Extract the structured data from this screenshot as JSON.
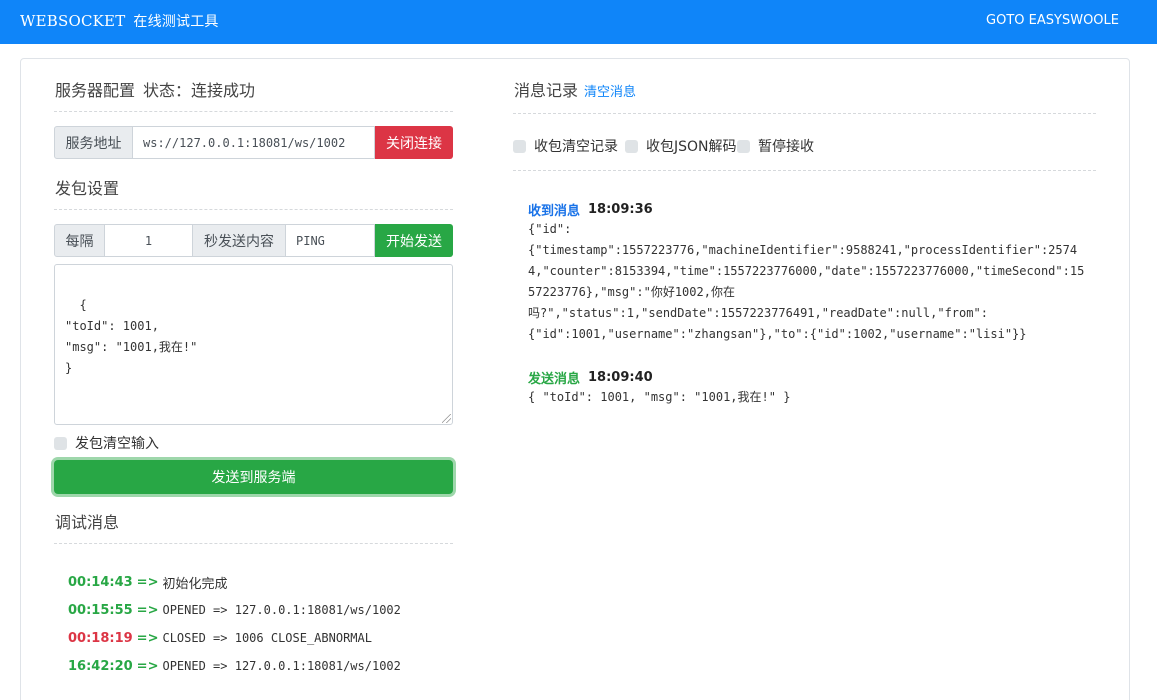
{
  "nav": {
    "brand": "WEBSOCKET",
    "subtitle": "在线测试工具",
    "link": "GOTO EASYSWOOLE"
  },
  "server": {
    "title": "服务器配置",
    "status": "状态：连接成功",
    "address_label": "服务地址",
    "address_value": "ws://127.0.0.1:18081/ws/1002",
    "close_button": "关闭连接"
  },
  "packet": {
    "title": "发包设置",
    "interval_label": "每隔",
    "interval_value": "1",
    "content_label": "秒发送内容",
    "content_value": "PING",
    "start_button": "开始发送",
    "body": "{\n\"toId\": 1001,\n\"msg\": \"1001,我在!\"\n}",
    "clear_input_label": "发包清空输入",
    "send_button": "发送到服务端"
  },
  "debug": {
    "title": "调试消息",
    "logs": [
      {
        "time": "00:14:43",
        "arrow": "=>",
        "text": "初始化完成"
      },
      {
        "time": "00:15:55",
        "arrow": "=>",
        "text": "OPENED => 127.0.0.1:18081/ws/1002"
      },
      {
        "time": "00:18:19",
        "arrow": "=>",
        "text": "CLOSED => 1006 CLOSE_ABNORMAL"
      },
      {
        "time": "16:42:20",
        "arrow": "=>",
        "text": "OPENED => 127.0.0.1:18081/ws/1002"
      }
    ]
  },
  "messages": {
    "title": "消息记录",
    "clear_link": "清空消息",
    "options": [
      "收包清空记录",
      "收包JSON解码",
      "暂停接收"
    ],
    "items": [
      {
        "type": "收到消息",
        "time": "18:09:36",
        "body": "{\"id\":\n{\"timestamp\":1557223776,\"machineIdentifier\":9588241,\"processIdentifier\":25744,\"counter\":8153394,\"time\":1557223776000,\"date\":1557223776000,\"timeSecond\":1557223776},\"msg\":\"你好1002,你在\n吗?\",\"status\":1,\"sendDate\":1557223776491,\"readDate\":null,\"from\":\n{\"id\":1001,\"username\":\"zhangsan\"},\"to\":{\"id\":1002,\"username\":\"lisi\"}}"
      },
      {
        "type": "发送消息",
        "time": "18:09:40",
        "body": "{ \"toId\": 1001, \"msg\": \"1001,我在!\" }"
      }
    ]
  },
  "colors": {
    "primary": "#0f85f9",
    "success": "#28a745",
    "danger": "#dc3545",
    "received": "#1a73e8",
    "sent": "#28a745"
  }
}
